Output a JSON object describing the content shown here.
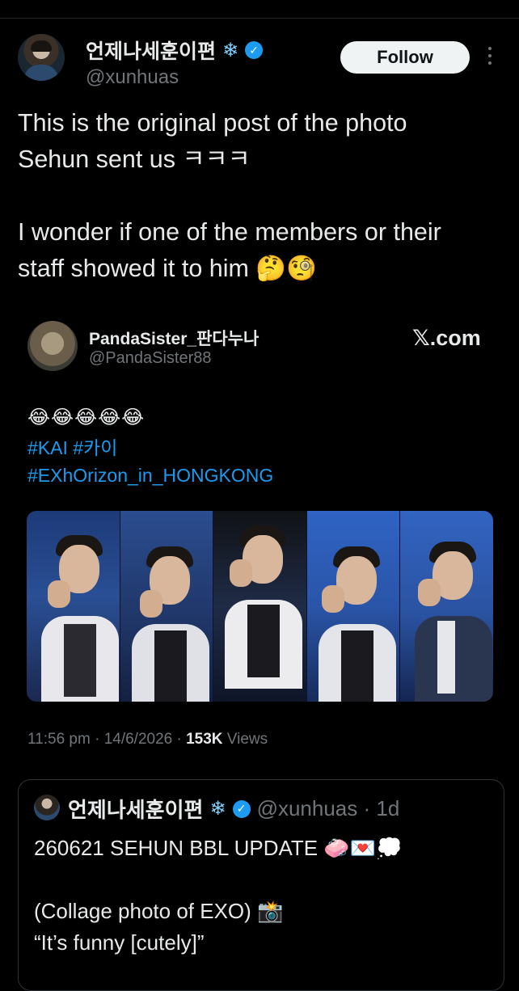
{
  "post": {
    "display_name": "언제나세훈이편",
    "snow_glyph": "❄",
    "verified_glyph": "✓",
    "handle": "@xunhuas",
    "follow_label": "Follow",
    "text": "This is the original post of the photo\nSehun sent us ㅋㅋㅋ\n\nI wonder if one of the members or their\nstaff showed it to him 🤔🧐"
  },
  "quoted": {
    "name": "PandaSister_판다누나",
    "handle": "@PandaSister88",
    "source": "𝕏.com",
    "emojis": "😂😂😂😂😂",
    "hashtags": "#KAI #카이\n#EXhOrizon_in_HONGKONG",
    "time": "11:56 pm · 14/6/2026 · ",
    "views_count": "153K",
    "views_label": " Views",
    "panels": 5
  },
  "bottom_quote": {
    "name": "언제나세훈이편",
    "snow_glyph": "❄",
    "verified_glyph": "✓",
    "meta": "@xunhuas · 1d",
    "text": "260621 SEHUN BBL UPDATE 🧼💌💭\n\n(Collage photo of EXO) 📸\n“It’s funny [cutely]”"
  },
  "colors": {
    "background": "#000000",
    "text": "#e7e9ea",
    "muted": "#71767b",
    "link": "#1d9bf0",
    "verified": "#1d9bf0"
  },
  "icons": [
    "profile-avatar",
    "snowflake-icon",
    "verified-badge-icon",
    "more-options-icon"
  ]
}
